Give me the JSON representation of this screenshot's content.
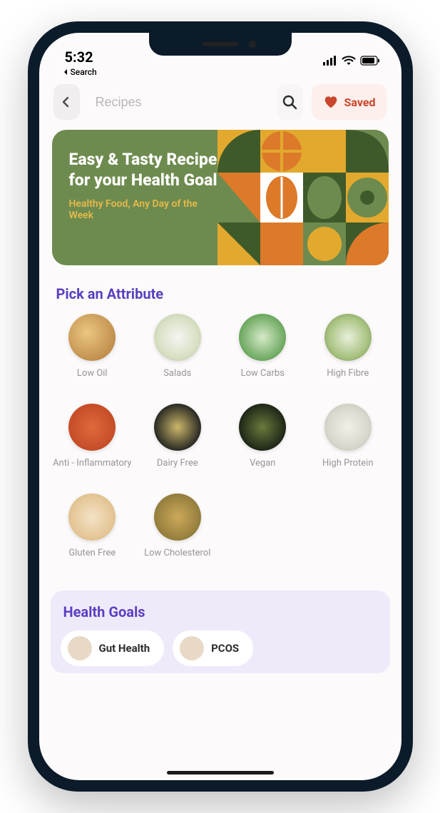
{
  "status": {
    "time": "5:32",
    "back_label": "Search"
  },
  "topbar": {
    "search_placeholder": "Recipes",
    "saved_label": "Saved"
  },
  "hero": {
    "title": "Easy & Tasty Recipes for your Health Goals",
    "subtitle": "Healthy Food, Any Day of the Week"
  },
  "attributes": {
    "heading": "Pick an Attribute",
    "items": [
      {
        "label": "Low Oil"
      },
      {
        "label": "Salads"
      },
      {
        "label": "Low Carbs"
      },
      {
        "label": "High Fibre"
      },
      {
        "label": "Anti - Inflammatory"
      },
      {
        "label": "Dairy Free"
      },
      {
        "label": "Vegan"
      },
      {
        "label": "High Protein"
      },
      {
        "label": "Gluten Free"
      },
      {
        "label": "Low Cholesterol"
      }
    ]
  },
  "goals": {
    "heading": "Health Goals",
    "items": [
      {
        "label": "Gut Health"
      },
      {
        "label": "PCOS"
      }
    ]
  }
}
